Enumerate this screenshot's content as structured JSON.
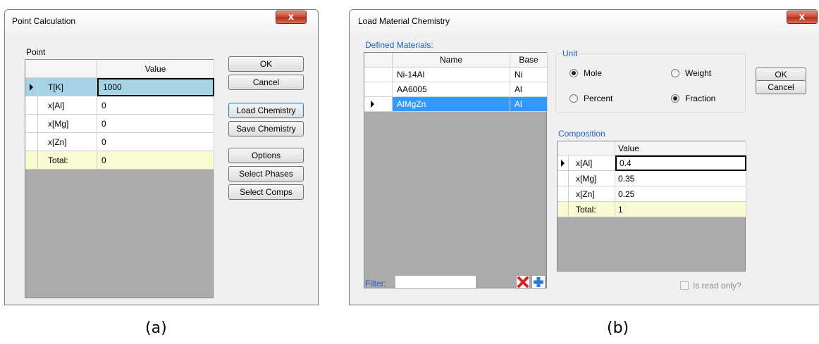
{
  "point_dialog": {
    "title": "Point Calculation",
    "close_label": "x",
    "group_label": "Point",
    "grid": {
      "column_header": "Value",
      "rows": [
        {
          "name": "T[K]",
          "value": "1000"
        },
        {
          "name": "x[Al]",
          "value": "0"
        },
        {
          "name": "x[Mg]",
          "value": "0"
        },
        {
          "name": "x[Zn]",
          "value": "0"
        },
        {
          "name": "Total:",
          "value": "0"
        }
      ]
    },
    "buttons": {
      "ok": "OK",
      "cancel": "Cancel",
      "load_chemistry": "Load Chemistry",
      "save_chemistry": "Save Chemistry",
      "options": "Options",
      "select_phases": "Select Phases",
      "select_comps": "Select Comps"
    }
  },
  "load_dialog": {
    "title": "Load Material Chemistry",
    "close_label": "x",
    "defined_materials_label": "Defined Materials:",
    "materials_grid": {
      "headers": [
        "Name",
        "Base"
      ],
      "rows": [
        {
          "name": "Ni-14Al",
          "base": "Ni"
        },
        {
          "name": "AA6005",
          "base": "Al"
        },
        {
          "name": "AlMgZn",
          "base": "Al"
        }
      ]
    },
    "filter_label": "Filter:",
    "filter_value": "",
    "unit": {
      "label": "Unit",
      "mole": "Mole",
      "weight": "Weight",
      "percent": "Percent",
      "fraction": "Fraction",
      "selected_type": "Mole",
      "selected_scale": "Fraction"
    },
    "composition": {
      "label": "Composition",
      "column_header": "Value",
      "rows": [
        {
          "name": "x[Al]",
          "value": "0.4"
        },
        {
          "name": "x[Mg]",
          "value": "0.35"
        },
        {
          "name": "x[Zn]",
          "value": "0.25"
        },
        {
          "name": "Total:",
          "value": "1"
        }
      ]
    },
    "read_only_label": "Is read only?",
    "buttons": {
      "ok": "OK",
      "cancel": "Cancel"
    }
  },
  "captions": {
    "a": "(a)",
    "b": "(b)"
  }
}
